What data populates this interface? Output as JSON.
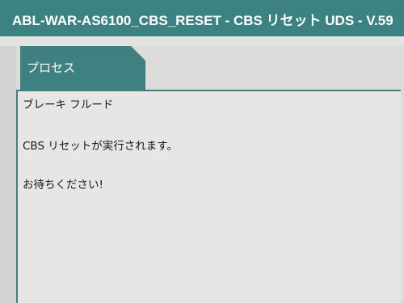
{
  "window": {
    "title": "ABL-WAR-AS6100_CBS_RESET - CBS リセット UDS - V.59"
  },
  "tab": {
    "label": "プロセス"
  },
  "content": {
    "lines": [
      "ブレーキ フルード",
      "CBS リセットが実行されます。",
      "お待ちください!"
    ]
  },
  "colors": {
    "title_bar": "#3d8282",
    "tab": "#3f8080",
    "panel_border": "#3f7f7f",
    "background": "#dcdcda"
  }
}
